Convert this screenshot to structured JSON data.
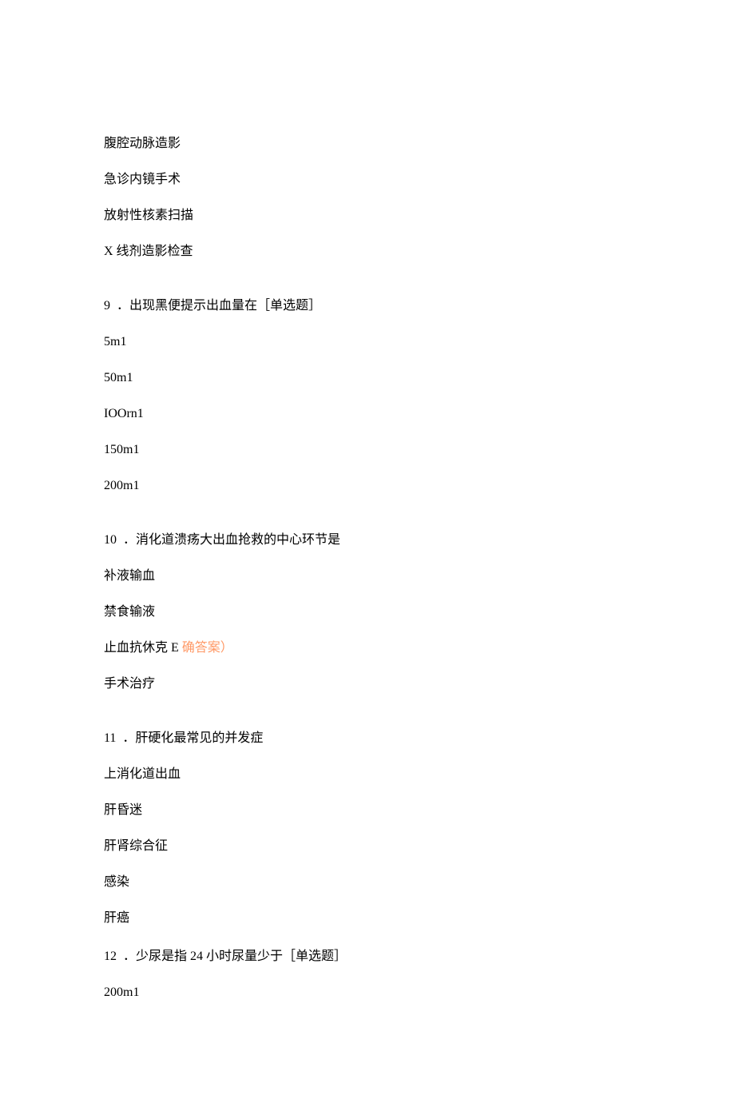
{
  "q8_options": {
    "a": "腹腔动脉造影",
    "b": "急诊内镜手术",
    "c": "放射性核素扫描",
    "d": "X 线剂造影检查"
  },
  "q9": {
    "number": "9",
    "sep": "．",
    "text": "出现黑便提示出血量在［单选题］",
    "options": {
      "a": "5m1",
      "b": "50m1",
      "c": "IOOrn1",
      "d": "150m1",
      "e": "200m1"
    }
  },
  "q10": {
    "number": "10",
    "sep": "．",
    "text": "消化道溃疡大出血抢救的中心环节是",
    "options": {
      "a": "补液输血",
      "b": "禁食输液",
      "c_text": "止血抗休克 E",
      "c_answer": " 确答案）",
      "d": "手术治疗"
    }
  },
  "q11": {
    "number": "11",
    "sep": "．",
    "text": "肝硬化最常见的并发症",
    "options": {
      "a": "上消化道出血",
      "b": "肝昏迷",
      "c": "肝肾综合征",
      "d": "感染",
      "e": "肝癌"
    }
  },
  "q12": {
    "number": "12",
    "sep": "．",
    "text": "少尿是指 24 小时尿量少于［单选题］",
    "options": {
      "a": "200m1"
    }
  }
}
